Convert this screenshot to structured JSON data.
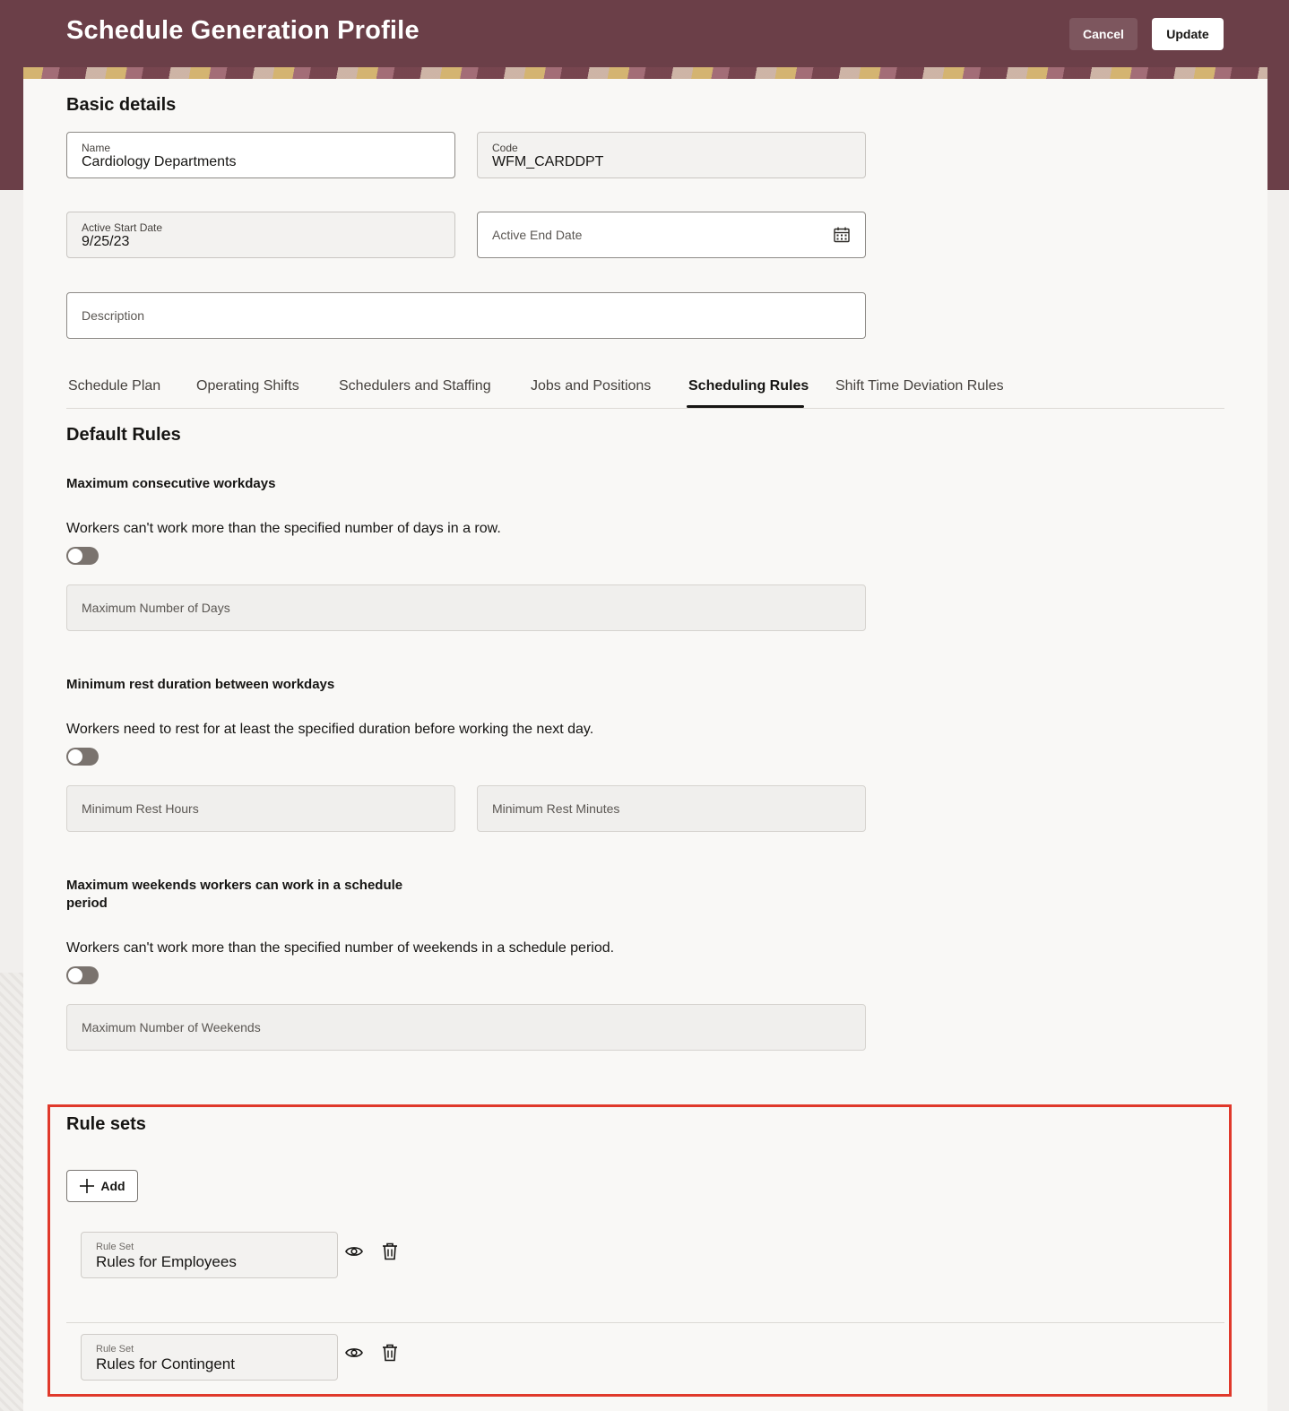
{
  "header": {
    "title": "Schedule Generation Profile",
    "cancel_label": "Cancel",
    "update_label": "Update"
  },
  "basic_details": {
    "heading": "Basic details",
    "name": {
      "label": "Name",
      "value": "Cardiology Departments"
    },
    "code": {
      "label": "Code",
      "value": "WFM_CARDDPT"
    },
    "active_start_date": {
      "label": "Active Start Date",
      "value": "9/25/23"
    },
    "active_end_date": {
      "placeholder": "Active End Date"
    },
    "description": {
      "placeholder": "Description"
    }
  },
  "tabs": [
    {
      "label": "Schedule Plan",
      "active": false
    },
    {
      "label": "Operating Shifts",
      "active": false
    },
    {
      "label": "Schedulers and Staffing",
      "active": false
    },
    {
      "label": "Jobs and Positions",
      "active": false
    },
    {
      "label": "Scheduling Rules",
      "active": true
    },
    {
      "label": "Shift Time Deviation Rules",
      "active": false
    }
  ],
  "default_rules": {
    "heading": "Default Rules",
    "max_consecutive": {
      "title": "Maximum consecutive workdays",
      "description": "Workers can't work more than the specified number of days in a row.",
      "enabled": false,
      "field_placeholder": "Maximum Number of Days"
    },
    "min_rest": {
      "title": "Minimum rest duration between workdays",
      "description": "Workers need to rest for at least the specified duration before working the next day.",
      "enabled": false,
      "hours_placeholder": "Minimum Rest Hours",
      "minutes_placeholder": "Minimum Rest Minutes"
    },
    "max_weekends": {
      "title_line1": "Maximum weekends workers can work in a schedule",
      "title_line2": "period",
      "description": "Workers can't work more than the specified number of weekends in a schedule period.",
      "enabled": false,
      "field_placeholder": "Maximum Number of Weekends"
    }
  },
  "rule_sets": {
    "heading": "Rule sets",
    "add_label": "Add",
    "items": [
      {
        "label": "Rule Set",
        "value": "Rules for Employees"
      },
      {
        "label": "Rule Set",
        "value": "Rules for Contingent"
      }
    ]
  },
  "icons": {
    "calendar": "calendar-icon",
    "view": "eye-icon",
    "delete": "trash-icon",
    "add": "plus-icon"
  },
  "colors": {
    "header_bg": "#6b3f48",
    "highlight_border": "#e0392b"
  }
}
